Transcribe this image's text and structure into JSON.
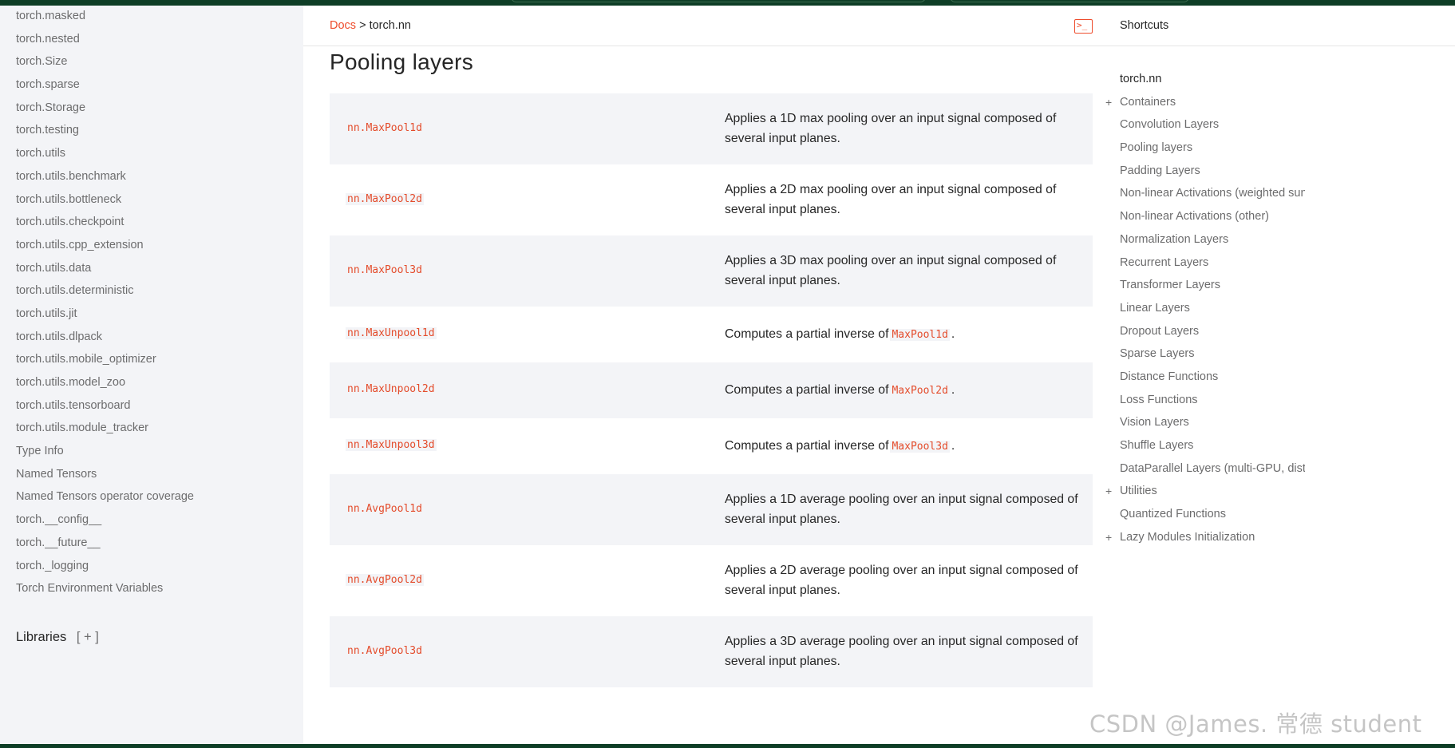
{
  "sidebar": {
    "items": [
      "torch.masked",
      "torch.nested",
      "torch.Size",
      "torch.sparse",
      "torch.Storage",
      "torch.testing",
      "torch.utils",
      "torch.utils.benchmark",
      "torch.utils.bottleneck",
      "torch.utils.checkpoint",
      "torch.utils.cpp_extension",
      "torch.utils.data",
      "torch.utils.deterministic",
      "torch.utils.jit",
      "torch.utils.dlpack",
      "torch.utils.mobile_optimizer",
      "torch.utils.model_zoo",
      "torch.utils.tensorboard",
      "torch.utils.module_tracker",
      "Type Info",
      "Named Tensors",
      "Named Tensors operator coverage",
      "torch.__config__",
      "torch.__future__",
      "torch._logging",
      "Torch Environment Variables"
    ],
    "libraries_label": "Libraries",
    "libraries_expand": "[ + ]"
  },
  "breadcrumb": {
    "root": "Docs",
    "separator": ">",
    "current": "torch.nn"
  },
  "header": {
    "terminal_icon": "terminal-icon",
    "shortcuts_label": "Shortcuts"
  },
  "main": {
    "section_title": "Pooling layers",
    "rows": [
      {
        "name": "nn.MaxPool1d",
        "desc": "Applies a 1D max pooling over an input signal composed of several input planes."
      },
      {
        "name": "nn.MaxPool2d",
        "desc": "Applies a 2D max pooling over an input signal composed of several input planes."
      },
      {
        "name": "nn.MaxPool3d",
        "desc": "Applies a 3D max pooling over an input signal composed of several input planes."
      },
      {
        "name": "nn.MaxUnpool1d",
        "desc_prefix": "Computes a partial inverse of",
        "desc_code": "MaxPool1d",
        "desc_suffix": "."
      },
      {
        "name": "nn.MaxUnpool2d",
        "desc_prefix": "Computes a partial inverse of",
        "desc_code": "MaxPool2d",
        "desc_suffix": "."
      },
      {
        "name": "nn.MaxUnpool3d",
        "desc_prefix": "Computes a partial inverse of",
        "desc_code": "MaxPool3d",
        "desc_suffix": "."
      },
      {
        "name": "nn.AvgPool1d",
        "desc": "Applies a 1D average pooling over an input signal composed of several input planes."
      },
      {
        "name": "nn.AvgPool2d",
        "desc": "Applies a 2D average pooling over an input signal composed of several input planes."
      },
      {
        "name": "nn.AvgPool3d",
        "desc": "Applies a 3D average pooling over an input signal composed of several input planes."
      }
    ]
  },
  "toc": {
    "root": "torch.nn",
    "items": [
      {
        "label": "Containers",
        "expandable": true
      },
      {
        "label": "Convolution Layers",
        "expandable": false
      },
      {
        "label": "Pooling layers",
        "expandable": false
      },
      {
        "label": "Padding Layers",
        "expandable": false
      },
      {
        "label": "Non-linear Activations (weighted sun",
        "expandable": false
      },
      {
        "label": "Non-linear Activations (other)",
        "expandable": false
      },
      {
        "label": "Normalization Layers",
        "expandable": false
      },
      {
        "label": "Recurrent Layers",
        "expandable": false
      },
      {
        "label": "Transformer Layers",
        "expandable": false
      },
      {
        "label": "Linear Layers",
        "expandable": false
      },
      {
        "label": "Dropout Layers",
        "expandable": false
      },
      {
        "label": "Sparse Layers",
        "expandable": false
      },
      {
        "label": "Distance Functions",
        "expandable": false
      },
      {
        "label": "Loss Functions",
        "expandable": false
      },
      {
        "label": "Vision Layers",
        "expandable": false
      },
      {
        "label": "Shuffle Layers",
        "expandable": false
      },
      {
        "label": "DataParallel Layers (multi-GPU, distri",
        "expandable": false
      },
      {
        "label": "Utilities",
        "expandable": true
      },
      {
        "label": "Quantized Functions",
        "expandable": false
      },
      {
        "label": "Lazy Modules Initialization",
        "expandable": true
      }
    ],
    "plus_glyph": "+"
  },
  "watermark": "CSDN @James. 常德 student",
  "colors": {
    "accent": "#ee4c2c",
    "sidebar_bg": "#f3f4f7",
    "top_band": "#0e3e26"
  }
}
